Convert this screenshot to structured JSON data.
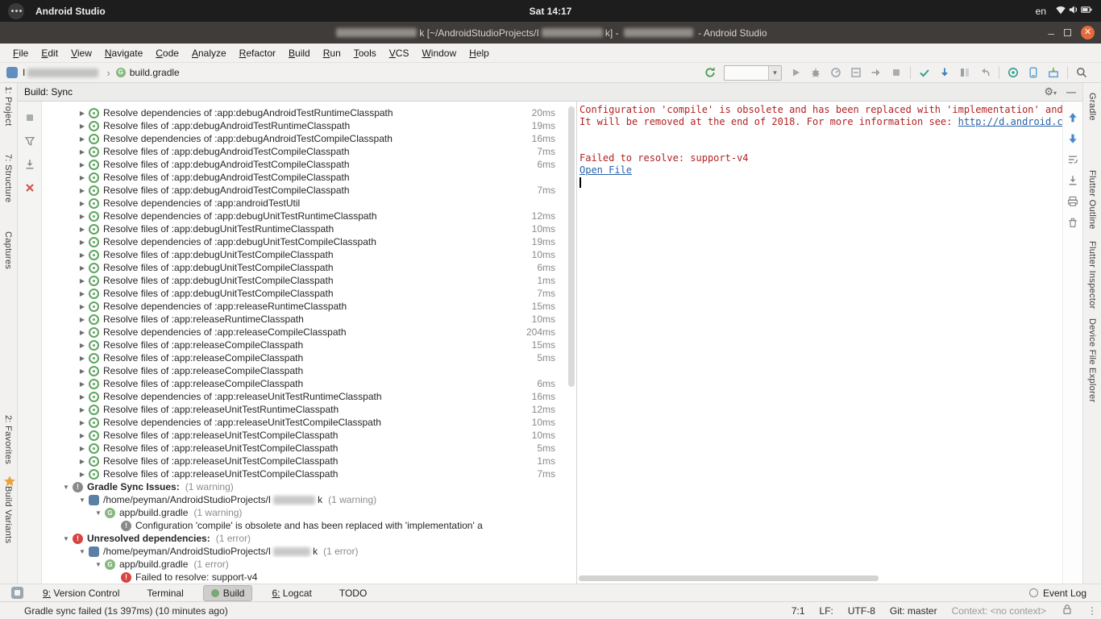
{
  "colors": {
    "accent_green": "#4a9b52",
    "console_error_red": "#B22222",
    "link_blue": "#2962A8",
    "close_button_orange": "#E66A3C"
  },
  "system_bar": {
    "app_name": "Android Studio",
    "clock": "Sat 14:17",
    "keyboard_layout": "en",
    "tray_icons": [
      "wifi",
      "volume",
      "battery"
    ]
  },
  "title_bar": {
    "segments": [
      {
        "blur": 100
      },
      {
        "text": "k [~/AndroidStudioProjects/I"
      },
      {
        "blur": 76
      },
      {
        "text": "k] - "
      },
      {
        "blur": 86
      },
      {
        "text": " - Android Studio"
      }
    ]
  },
  "menu_bar": {
    "items": [
      "File",
      "Edit",
      "View",
      "Navigate",
      "Code",
      "Analyze",
      "Refactor",
      "Build",
      "Run",
      "Tools",
      "VCS",
      "Window",
      "Help"
    ]
  },
  "toolbar": {
    "project_segments": [
      {
        "text": "I"
      },
      {
        "blur": 88
      }
    ],
    "breadcrumb_separator": "›",
    "breadcrumb_file": "build.gradle",
    "icons_before_combo": [
      "sync-gradle"
    ],
    "icons_after_combo": [
      "run",
      "debug",
      "profile",
      "coverage",
      "attach-debugger",
      "stop",
      "commit",
      "update-project",
      "diff",
      "undo",
      "inspections",
      "avd-manager",
      "sdk-manager",
      "search-everywhere"
    ]
  },
  "left_strip": {
    "items": [
      "1: Project",
      "7: Structure",
      "Captures",
      "2: Favorites",
      "Build Variants"
    ]
  },
  "right_strip": {
    "items": [
      "Gradle",
      "Flutter Outline",
      "Flutter Inspector",
      "Device File Explorer"
    ]
  },
  "build_panel": {
    "title": "Build: Sync",
    "header_icons": [
      "settings",
      "hide"
    ],
    "toolbar_icons": [
      "stop",
      "filter",
      "expand-all",
      "close"
    ],
    "rows": [
      {
        "indent": 2,
        "arrow": "c",
        "icon": "task",
        "text": "Resolve dependencies of :app:debugAndroidTestRuntimeClasspath",
        "time": "20ms"
      },
      {
        "indent": 2,
        "arrow": "c",
        "icon": "task",
        "text": "Resolve files of :app:debugAndroidTestRuntimeClasspath",
        "time": "19ms"
      },
      {
        "indent": 2,
        "arrow": "c",
        "icon": "task",
        "text": "Resolve dependencies of :app:debugAndroidTestCompileClasspath",
        "time": "16ms"
      },
      {
        "indent": 2,
        "arrow": "c",
        "icon": "task",
        "text": "Resolve files of :app:debugAndroidTestCompileClasspath",
        "time": "7ms"
      },
      {
        "indent": 2,
        "arrow": "c",
        "icon": "task",
        "text": "Resolve files of :app:debugAndroidTestCompileClasspath",
        "time": "6ms"
      },
      {
        "indent": 2,
        "arrow": "c",
        "icon": "task",
        "text": "Resolve files of :app:debugAndroidTestCompileClasspath",
        "time": ""
      },
      {
        "indent": 2,
        "arrow": "c",
        "icon": "task",
        "text": "Resolve files of :app:debugAndroidTestCompileClasspath",
        "time": "7ms"
      },
      {
        "indent": 2,
        "arrow": "c",
        "icon": "task",
        "text": "Resolve dependencies of :app:androidTestUtil",
        "time": ""
      },
      {
        "indent": 2,
        "arrow": "c",
        "icon": "task",
        "text": "Resolve dependencies of :app:debugUnitTestRuntimeClasspath",
        "time": "12ms"
      },
      {
        "indent": 2,
        "arrow": "c",
        "icon": "task",
        "text": "Resolve files of :app:debugUnitTestRuntimeClasspath",
        "time": "10ms"
      },
      {
        "indent": 2,
        "arrow": "c",
        "icon": "task",
        "text": "Resolve dependencies of :app:debugUnitTestCompileClasspath",
        "time": "19ms"
      },
      {
        "indent": 2,
        "arrow": "c",
        "icon": "task",
        "text": "Resolve files of :app:debugUnitTestCompileClasspath",
        "time": "10ms"
      },
      {
        "indent": 2,
        "arrow": "c",
        "icon": "task",
        "text": "Resolve files of :app:debugUnitTestCompileClasspath",
        "time": "6ms"
      },
      {
        "indent": 2,
        "arrow": "c",
        "icon": "task",
        "text": "Resolve files of :app:debugUnitTestCompileClasspath",
        "time": "1ms"
      },
      {
        "indent": 2,
        "arrow": "c",
        "icon": "task",
        "text": "Resolve files of :app:debugUnitTestCompileClasspath",
        "time": "7ms"
      },
      {
        "indent": 2,
        "arrow": "c",
        "icon": "task",
        "text": "Resolve dependencies of :app:releaseRuntimeClasspath",
        "time": "15ms"
      },
      {
        "indent": 2,
        "arrow": "c",
        "icon": "task",
        "text": "Resolve files of :app:releaseRuntimeClasspath",
        "time": "10ms"
      },
      {
        "indent": 2,
        "arrow": "c",
        "icon": "task",
        "text": "Resolve dependencies of :app:releaseCompileClasspath",
        "time": "204ms"
      },
      {
        "indent": 2,
        "arrow": "c",
        "icon": "task",
        "text": "Resolve files of :app:releaseCompileClasspath",
        "time": "15ms"
      },
      {
        "indent": 2,
        "arrow": "c",
        "icon": "task",
        "text": "Resolve files of :app:releaseCompileClasspath",
        "time": "5ms"
      },
      {
        "indent": 2,
        "arrow": "c",
        "icon": "task",
        "text": "Resolve files of :app:releaseCompileClasspath",
        "time": ""
      },
      {
        "indent": 2,
        "arrow": "c",
        "icon": "task",
        "text": "Resolve files of :app:releaseCompileClasspath",
        "time": "6ms"
      },
      {
        "indent": 2,
        "arrow": "c",
        "icon": "task",
        "text": "Resolve dependencies of :app:releaseUnitTestRuntimeClasspath",
        "time": "16ms"
      },
      {
        "indent": 2,
        "arrow": "c",
        "icon": "task",
        "text": "Resolve files of :app:releaseUnitTestRuntimeClasspath",
        "time": "12ms"
      },
      {
        "indent": 2,
        "arrow": "c",
        "icon": "task",
        "text": "Resolve dependencies of :app:releaseUnitTestCompileClasspath",
        "time": "10ms"
      },
      {
        "indent": 2,
        "arrow": "c",
        "icon": "task",
        "text": "Resolve files of :app:releaseUnitTestCompileClasspath",
        "time": "10ms"
      },
      {
        "indent": 2,
        "arrow": "c",
        "icon": "task",
        "text": "Resolve files of :app:releaseUnitTestCompileClasspath",
        "time": "5ms"
      },
      {
        "indent": 2,
        "arrow": "c",
        "icon": "task",
        "text": "Resolve files of :app:releaseUnitTestCompileClasspath",
        "time": "1ms"
      },
      {
        "indent": 2,
        "arrow": "c",
        "icon": "task",
        "text": "Resolve files of :app:releaseUnitTestCompileClasspath",
        "time": "7ms"
      },
      {
        "indent": 1,
        "arrow": "e",
        "icon": "warning",
        "bold": true,
        "text": "Gradle Sync Issues:",
        "badge": "(1 warning)"
      },
      {
        "indent": 2,
        "arrow": "e",
        "icon": "folder",
        "text": "/home/peyman/AndroidStudioProjects/I",
        "blur": 52,
        "text2": "k",
        "badge": "(1 warning)"
      },
      {
        "indent": 3,
        "arrow": "e",
        "icon": "gradle",
        "text": "app/build.gradle",
        "badge": "(1 warning)"
      },
      {
        "indent": 4,
        "icon": "warning",
        "text": "Configuration 'compile' is obsolete and has been replaced with 'implementation' a"
      },
      {
        "indent": 1,
        "arrow": "e",
        "icon": "error",
        "bold": true,
        "text": "Unresolved dependencies:",
        "badge": "(1 error)"
      },
      {
        "indent": 2,
        "arrow": "e",
        "icon": "folder",
        "text": "/home/peyman/AndroidStudioProjects/I",
        "blur": 46,
        "text2": "k",
        "badge": "(1 error)"
      },
      {
        "indent": 3,
        "arrow": "e",
        "icon": "gradle",
        "text": "app/build.gradle",
        "badge": "(1 error)"
      },
      {
        "indent": 4,
        "icon": "error",
        "text": "Failed to resolve: support-v4"
      }
    ]
  },
  "console": {
    "lines": [
      {
        "text": "Configuration 'compile' is obsolete and has been replaced with 'implementation' and 'a"
      },
      {
        "text": "It will be removed at the end of 2018. For more information see: ",
        "link": "http://d.android.com/"
      },
      {},
      {},
      {
        "text": "Failed to resolve: support-v4"
      },
      {
        "link": "Open File"
      }
    ],
    "toolbar_icons": [
      "scroll-up",
      "scroll-down",
      "soft-wrap",
      "scroll-to-end",
      "print",
      "clear-all"
    ]
  },
  "bottom_bar": {
    "items": [
      {
        "label": "9: Version Control",
        "mnemonic": true
      },
      {
        "label": "Terminal"
      },
      {
        "label": "Build",
        "selected": true,
        "icon": true
      },
      {
        "label": "6: Logcat",
        "mnemonic": true
      },
      {
        "label": "TODO"
      }
    ],
    "event_log": "Event Log"
  },
  "status_bar": {
    "message": "Gradle sync failed (1s 397ms) (10 minutes ago)",
    "position": "7:1",
    "line_separator": "LF:",
    "encoding": "UTF-8",
    "vcs": "Git: master",
    "context": "Context: <no context>"
  }
}
